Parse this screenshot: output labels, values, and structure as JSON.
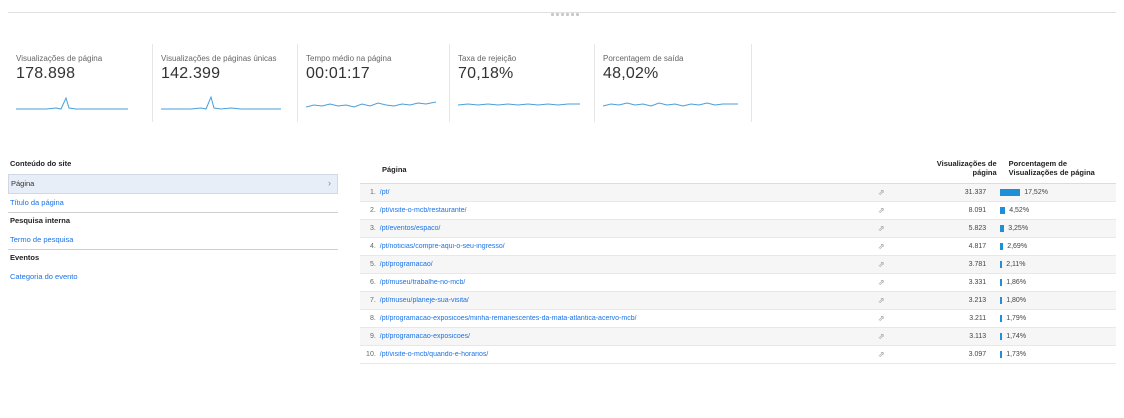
{
  "metrics": [
    {
      "label": "Visualizações de página",
      "value": "178.898"
    },
    {
      "label": "Visualizações de páginas únicas",
      "value": "142.399"
    },
    {
      "label": "Tempo médio na página",
      "value": "00:01:17"
    },
    {
      "label": "Taxa de rejeição",
      "value": "70,18%"
    },
    {
      "label": "Porcentagem de saída",
      "value": "48,02%"
    }
  ],
  "sidebar": {
    "sections": [
      {
        "title": "Conteúdo do site",
        "items": [
          "Página",
          "Título da página"
        ]
      },
      {
        "title": "Pesquisa interna",
        "items": [
          "Termo de pesquisa"
        ]
      },
      {
        "title": "Eventos",
        "items": [
          "Categoria do evento"
        ]
      }
    ],
    "selected_item": "Página"
  },
  "table": {
    "headers": {
      "page": "Página",
      "views_line1": "Visualizações de",
      "views_line2": "página",
      "pct_line1": "Porcentagem de",
      "pct_line2": "Visualizações de página"
    },
    "rows": [
      {
        "idx": "1.",
        "page": "/pt/",
        "views": "31.337",
        "pct": "17,52%",
        "pct_value": 17.52
      },
      {
        "idx": "2.",
        "page": "/pt/visite-o-mcb/restaurante/",
        "views": "8.091",
        "pct": "4,52%",
        "pct_value": 4.52
      },
      {
        "idx": "3.",
        "page": "/pt/eventos/espaco/",
        "views": "5.823",
        "pct": "3,25%",
        "pct_value": 3.25
      },
      {
        "idx": "4.",
        "page": "/pt/noticias/compre-aqui-o-seu-ingresso/",
        "views": "4.817",
        "pct": "2,69%",
        "pct_value": 2.69
      },
      {
        "idx": "5.",
        "page": "/pt/programacao/",
        "views": "3.781",
        "pct": "2,11%",
        "pct_value": 2.11
      },
      {
        "idx": "6.",
        "page": "/pt/museu/trabalhe-no-mcb/",
        "views": "3.331",
        "pct": "1,86%",
        "pct_value": 1.86
      },
      {
        "idx": "7.",
        "page": "/pt/museu/planeje-sua-visita/",
        "views": "3.213",
        "pct": "1,80%",
        "pct_value": 1.8
      },
      {
        "idx": "8.",
        "page": "/pt/programacao-exposicoes/minha-remanescentes-da-mata-atlantica-acervo-mcb/",
        "views": "3.211",
        "pct": "1,79%",
        "pct_value": 1.79
      },
      {
        "idx": "9.",
        "page": "/pt/programacao-exposicoes/",
        "views": "3.113",
        "pct": "1,74%",
        "pct_value": 1.74
      },
      {
        "idx": "10.",
        "page": "/pt/visite-o-mcb/quando-e-horarios/",
        "views": "3.097",
        "pct": "1,73%",
        "pct_value": 1.73
      }
    ]
  },
  "colors": {
    "accent": "#1a73e8",
    "bar": "#1f8fd8",
    "sparkline": "#4a9fd8"
  },
  "icons": {
    "row_link": "external-link-icon",
    "selected_arrow": "chevron-right-icon"
  }
}
